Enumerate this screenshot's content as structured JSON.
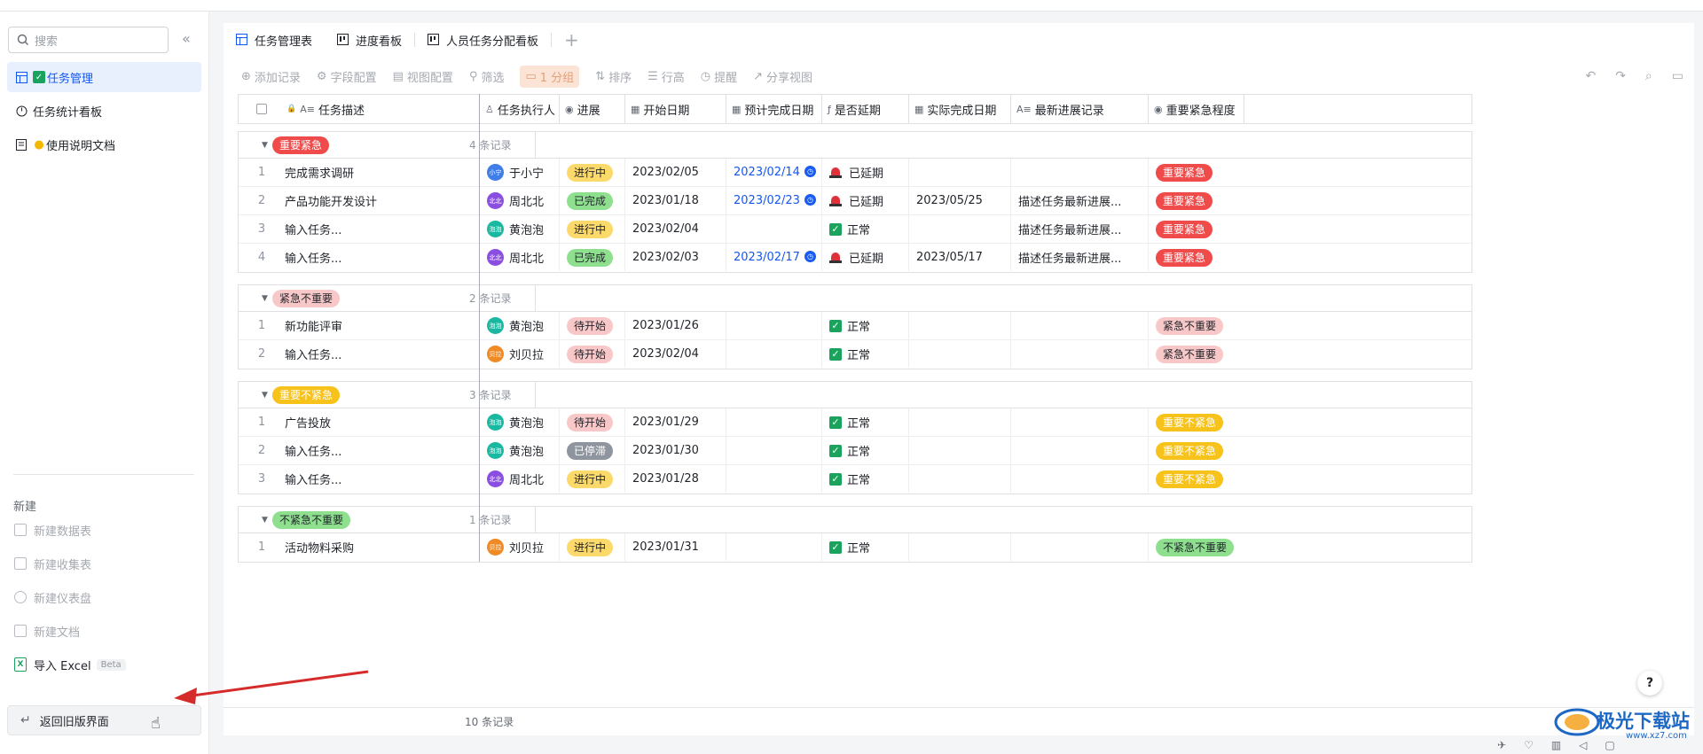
{
  "sidebar": {
    "search_placeholder": "搜索",
    "collapse_glyph": "«",
    "items": [
      {
        "label": "任务管理",
        "icon": "table-icon",
        "active": true
      },
      {
        "label": "任务统计看板",
        "icon": "dashboard-icon",
        "active": false
      },
      {
        "label": "使用说明文档",
        "icon": "doc-icon",
        "active": false
      }
    ],
    "new_section_title": "新建",
    "new_items": [
      {
        "label": "新建数据表",
        "icon": "table-icon"
      },
      {
        "label": "新建收集表",
        "icon": "form-icon"
      },
      {
        "label": "新建仪表盘",
        "icon": "dashboard-icon"
      },
      {
        "label": "新建文档",
        "icon": "doc-icon"
      }
    ],
    "import_excel": {
      "label": "导入 Excel",
      "badge": "Beta",
      "icon_text": "X"
    },
    "back_button": "返回旧版界面"
  },
  "tabs": [
    {
      "label": "任务管理表",
      "icon": "table-icon",
      "active": true
    },
    {
      "label": "进度看板",
      "icon": "kanban-icon",
      "active": false
    },
    {
      "label": "人员任务分配看板",
      "icon": "kanban-icon",
      "active": false
    }
  ],
  "tab_add": "+",
  "toolbar": {
    "add_record": "添加记录",
    "field_config": "字段配置",
    "view_config": "视图配置",
    "filter": "筛选",
    "group": "1 分组",
    "sort": "排序",
    "row_height": "行高",
    "remind": "提醒",
    "share_view": "分享视图"
  },
  "columns": [
    "任务描述",
    "任务执行人",
    "进展",
    "开始日期",
    "预计完成日期",
    "是否延期",
    "实际完成日期",
    "最新进展记录",
    "重要紧急程度"
  ],
  "groups": [
    {
      "label": "重要紧急",
      "count": "4 条记录",
      "tag_bg": "#ef4b4b",
      "tag_fg": "#ffffff",
      "rows": [
        {
          "n": "1",
          "desc": "完成需求调研",
          "person": "于小宁",
          "av": "小宁",
          "av_color": "#3f7de8",
          "status": "进行中",
          "status_key": "doing",
          "start": "2023/02/05",
          "due": "2023/02/14",
          "alarm": true,
          "delay": "已延期",
          "delayed": true,
          "done": "",
          "note": "",
          "prio": "重要紧急"
        },
        {
          "n": "2",
          "desc": "产品功能开发设计",
          "person": "周北北",
          "av": "北北",
          "av_color": "#8a4fe0",
          "status": "已完成",
          "status_key": "done",
          "start": "2023/01/18",
          "due": "2023/02/23",
          "alarm": true,
          "delay": "已延期",
          "delayed": true,
          "done": "2023/05/25",
          "note": "描述任务最新进展...",
          "prio": "重要紧急"
        },
        {
          "n": "3",
          "desc": "输入任务...",
          "person": "黄泡泡",
          "av": "泡泡",
          "av_color": "#1ab8a0",
          "status": "进行中",
          "status_key": "doing",
          "start": "2023/02/04",
          "due": "",
          "alarm": false,
          "delay": "正常",
          "delayed": false,
          "done": "",
          "note": "描述任务最新进展...",
          "prio": "重要紧急"
        },
        {
          "n": "4",
          "desc": "输入任务...",
          "person": "周北北",
          "av": "北北",
          "av_color": "#8a4fe0",
          "status": "已完成",
          "status_key": "done",
          "start": "2023/02/03",
          "due": "2023/02/17",
          "alarm": true,
          "delay": "已延期",
          "delayed": true,
          "done": "2023/05/17",
          "note": "描述任务最新进展...",
          "prio": "重要紧急"
        }
      ]
    },
    {
      "label": "紧急不重要",
      "count": "2 条记录",
      "tag_bg": "#f8c8c8",
      "tag_fg": "#1f2329",
      "rows": [
        {
          "n": "1",
          "desc": "新功能评审",
          "person": "黄泡泡",
          "av": "泡泡",
          "av_color": "#1ab8a0",
          "status": "待开始",
          "status_key": "todo",
          "start": "2023/01/26",
          "due": "",
          "alarm": false,
          "delay": "正常",
          "delayed": false,
          "done": "",
          "note": "",
          "prio": "紧急不重要"
        },
        {
          "n": "2",
          "desc": "输入任务...",
          "person": "刘贝拉",
          "av": "贝拉",
          "av_color": "#f08a24",
          "status": "待开始",
          "status_key": "todo",
          "start": "2023/02/04",
          "due": "",
          "alarm": false,
          "delay": "正常",
          "delayed": false,
          "done": "",
          "note": "",
          "prio": "紧急不重要"
        }
      ]
    },
    {
      "label": "重要不紧急",
      "count": "3 条记录",
      "tag_bg": "#f7c21a",
      "tag_fg": "#ffffff",
      "rows": [
        {
          "n": "1",
          "desc": "广告投放",
          "person": "黄泡泡",
          "av": "泡泡",
          "av_color": "#1ab8a0",
          "status": "待开始",
          "status_key": "todo",
          "start": "2023/01/29",
          "due": "",
          "alarm": false,
          "delay": "正常",
          "delayed": false,
          "done": "",
          "note": "",
          "prio": "重要不紧急"
        },
        {
          "n": "2",
          "desc": "输入任务...",
          "person": "黄泡泡",
          "av": "泡泡",
          "av_color": "#1ab8a0",
          "status": "已停滞",
          "status_key": "stop",
          "start": "2023/01/30",
          "due": "",
          "alarm": false,
          "delay": "正常",
          "delayed": false,
          "done": "",
          "note": "",
          "prio": "重要不紧急"
        },
        {
          "n": "3",
          "desc": "输入任务...",
          "person": "周北北",
          "av": "北北",
          "av_color": "#8a4fe0",
          "status": "进行中",
          "status_key": "doing",
          "start": "2023/01/28",
          "due": "",
          "alarm": false,
          "delay": "正常",
          "delayed": false,
          "done": "",
          "note": "",
          "prio": "重要不紧急"
        }
      ]
    },
    {
      "label": "不紧急不重要",
      "count": "1 条记录",
      "tag_bg": "#8ee08e",
      "tag_fg": "#1f2329",
      "rows": [
        {
          "n": "1",
          "desc": "活动物料采购",
          "person": "刘贝拉",
          "av": "贝拉",
          "av_color": "#f08a24",
          "status": "进行中",
          "status_key": "doing",
          "start": "2023/01/31",
          "due": "",
          "alarm": false,
          "delay": "正常",
          "delayed": false,
          "done": "",
          "note": "",
          "prio": "不紧急不重要"
        }
      ]
    }
  ],
  "status_colors": {
    "doing": {
      "bg": "#fbd96a",
      "fg": "#1f2329"
    },
    "done": {
      "bg": "#8ee08e",
      "fg": "#1f2329"
    },
    "todo": {
      "bg": "#f8c8c8",
      "fg": "#1f2329"
    },
    "stop": {
      "bg": "#8f959e",
      "fg": "#ffffff"
    }
  },
  "footer_count": "10 条记录",
  "help_glyph": "?",
  "watermark": {
    "title": "极光下载站",
    "sub": "www.xz7.com"
  }
}
